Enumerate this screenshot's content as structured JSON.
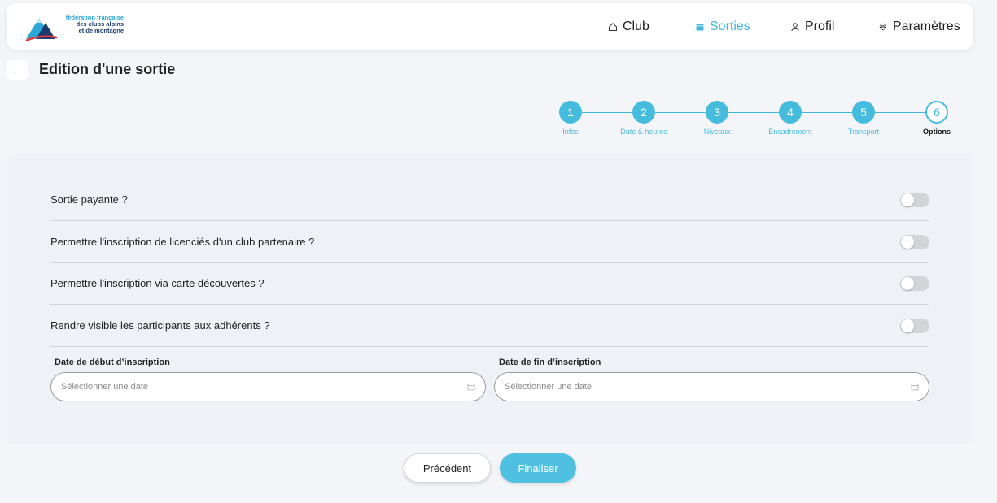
{
  "brand": {
    "logo_line1": "fédération française",
    "logo_line2": "des clubs alpins",
    "logo_line3": "et de montagne",
    "accent_color": "#45bcdd"
  },
  "nav": {
    "items": [
      {
        "label": "Club",
        "icon": "home-icon"
      },
      {
        "label": "Sorties",
        "icon": "calendar-icon",
        "active": true
      },
      {
        "label": "Profil",
        "icon": "user-icon"
      },
      {
        "label": "Paramètres",
        "icon": "gear-icon"
      }
    ]
  },
  "page": {
    "title": "Edition d'une sortie",
    "back_icon": "arrow-left-icon"
  },
  "stepper": {
    "steps": [
      {
        "number": "1",
        "label": "Infos"
      },
      {
        "number": "2",
        "label": "Date & heures"
      },
      {
        "number": "3",
        "label": "Niveaux"
      },
      {
        "number": "4",
        "label": "Encadrement"
      },
      {
        "number": "5",
        "label": "Transport"
      },
      {
        "number": "6",
        "label": "Options",
        "current": true
      }
    ]
  },
  "options": [
    {
      "label": "Sortie payante ?",
      "enabled": false
    },
    {
      "label": "Permettre l'inscription de licenciés d'un club partenaire ?",
      "enabled": false
    },
    {
      "label": "Permettre l'inscription via carte découvertes ?",
      "enabled": false
    },
    {
      "label": "Rendre visible les participants aux adhérents ?",
      "enabled": false
    }
  ],
  "dates": {
    "start_label": "Date de début d’inscription",
    "start_placeholder": "Sélectionner une date",
    "end_label": "Date de fin d’inscription",
    "end_placeholder": "Sélectionner une date"
  },
  "footer": {
    "prev_label": "Précédent",
    "finish_label": "Finaliser"
  }
}
